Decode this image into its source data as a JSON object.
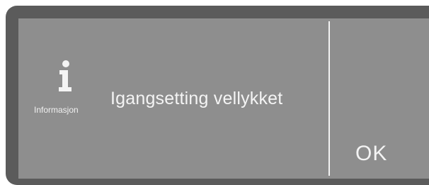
{
  "dialog": {
    "icon": "info-icon",
    "icon_caption": "Informasjon",
    "message": "Igangsetting vellykket",
    "ok_label": "OK"
  },
  "colors": {
    "frame": "#5b5b5b",
    "screen": "#8e8e8e",
    "text": "#f4f4f4"
  }
}
